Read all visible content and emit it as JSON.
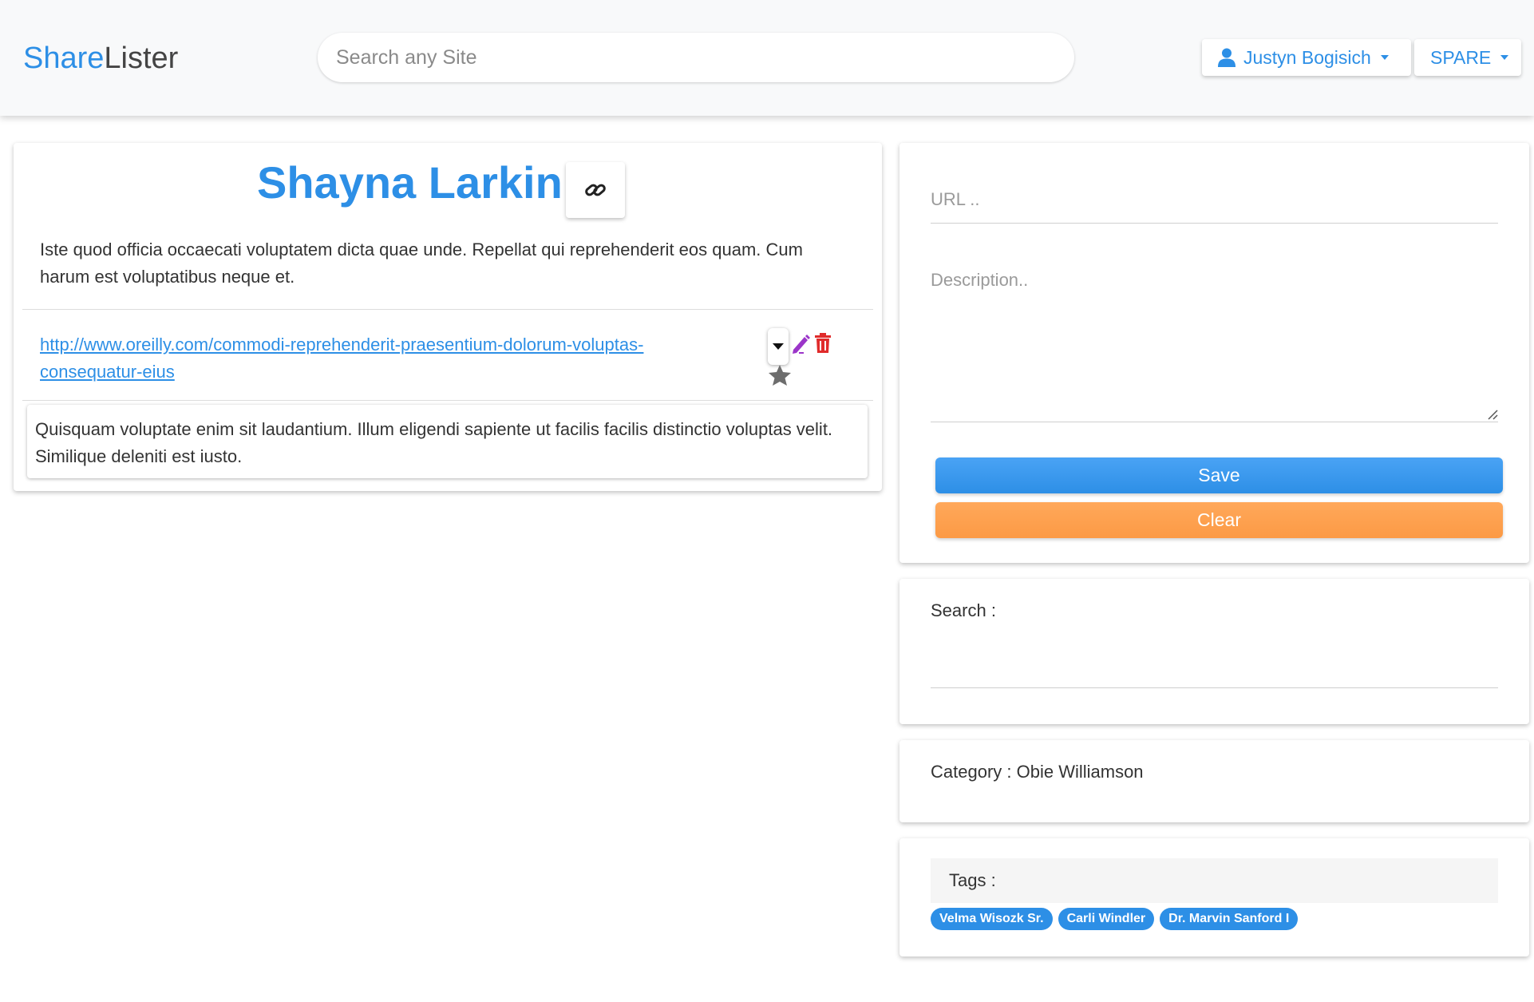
{
  "brand": {
    "part1": "Share",
    "part2": "Lister"
  },
  "search": {
    "placeholder": "Search any Site"
  },
  "nav": {
    "user_label": "Justyn Bogisich",
    "spare_label": "SPARE"
  },
  "entry": {
    "title": "Shayna Larkin",
    "description": "Iste quod officia occaecati voluptatem dicta quae unde. Repellat qui reprehenderit eos quam. Cum harum est voluptatibus neque et.",
    "url": "http://www.oreilly.com/commodi-reprehenderit-praesentium-dolorum-voluptas-consequatur-eius",
    "note": "Quisquam voluptate enim sit laudantium. Illum eligendi sapiente ut facilis facilis distinctio voluptas velit. Similique deleniti est iusto."
  },
  "form": {
    "url_placeholder": "URL ..",
    "description_placeholder": "Description..",
    "save_label": "Save",
    "clear_label": "Clear"
  },
  "search_panel": {
    "label": "Search :"
  },
  "category": {
    "text": "Category : Obie Williamson"
  },
  "tags": {
    "label": "Tags :",
    "items": [
      "Velma Wisozk Sr.",
      "Carli Windler",
      "Dr. Marvin Sanford I"
    ]
  },
  "colors": {
    "primary": "#2d8fe6",
    "save": "#3898ec",
    "clear": "#fd9c4b",
    "edit": "#9b35c9",
    "delete": "#e02b2b",
    "star": "#6d6d6d"
  },
  "icons": {
    "user": "user-icon",
    "link": "link-icon",
    "dropdown": "caret-down-icon",
    "edit": "pencil-icon",
    "delete": "trash-icon",
    "favorite": "star-icon"
  }
}
